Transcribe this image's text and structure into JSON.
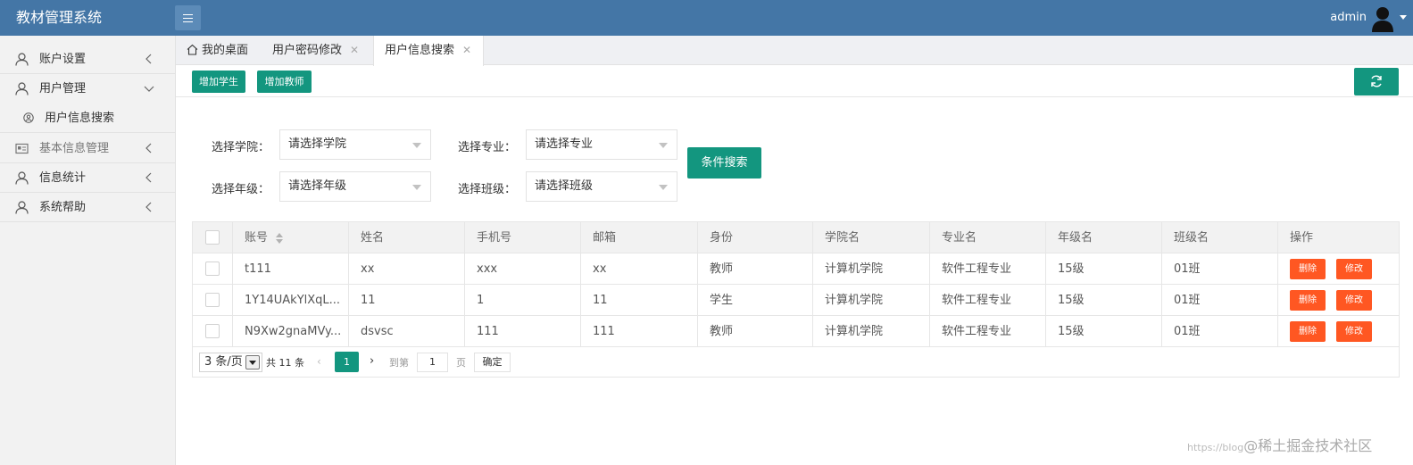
{
  "app": {
    "title": "教材管理系统",
    "user": "admin"
  },
  "sidebar": {
    "items": [
      {
        "label": "账户设置"
      },
      {
        "label": "用户管理"
      },
      {
        "label": "用户信息搜索"
      },
      {
        "label": "基本信息管理"
      },
      {
        "label": "信息统计"
      },
      {
        "label": "系统帮助"
      }
    ]
  },
  "tabs": [
    {
      "label": "我的桌面"
    },
    {
      "label": "用户密码修改"
    },
    {
      "label": "用户信息搜索",
      "active": true
    }
  ],
  "toolbar": {
    "add_student": "增加学生",
    "add_teacher": "增加教师"
  },
  "filters": {
    "college_label": "选择学院：",
    "college_value": "请选择学院",
    "major_label": "选择专业：",
    "major_value": "请选择专业",
    "grade_label": "选择年级：",
    "grade_value": "请选择年级",
    "class_label": "选择班级：",
    "class_value": "请选择班级",
    "search_button": "条件搜索"
  },
  "table": {
    "headers": [
      "账号",
      "姓名",
      "手机号",
      "邮箱",
      "身份",
      "学院名",
      "专业名",
      "年级名",
      "班级名",
      "操作"
    ],
    "rows": [
      [
        "t111",
        "xx",
        "xxx",
        "xx",
        "教师",
        "计算机学院",
        "软件工程专业",
        "15级",
        "01班"
      ],
      [
        "1Y14UAkYlXqL...",
        "11",
        "1",
        "11",
        "学生",
        "计算机学院",
        "软件工程专业",
        "15级",
        "01班"
      ],
      [
        "N9Xw2gnaMVy...",
        "dsvsc",
        "111",
        "111",
        "教师",
        "计算机学院",
        "软件工程专业",
        "15级",
        "01班"
      ]
    ],
    "delete_label": "删除",
    "edit_label": "修改"
  },
  "pager": {
    "page_size": "3 条/页",
    "total": "共 11 条",
    "current_page": "1",
    "goto_label": "到第",
    "goto_value": "1",
    "page_unit": "页",
    "confirm": "确定"
  },
  "watermark": {
    "url": "https://blog",
    "text": "@稀土掘金技术社区"
  },
  "colors": {
    "header": "#4476a6",
    "accent": "#13967f",
    "danger": "#ff5722",
    "sidebar": "#f2f2f2"
  }
}
